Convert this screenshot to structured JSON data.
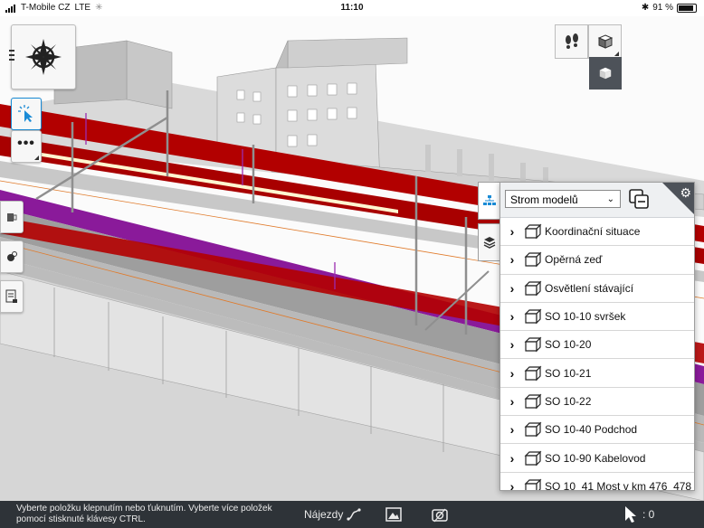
{
  "status_bar": {
    "carrier": "T-Mobile CZ",
    "network": "LTE",
    "time": "11:10",
    "battery": "91 %"
  },
  "colors": {
    "accent": "#1a8bd6",
    "panel_dark": "#4d5259",
    "bottom_bar": "#2e3338",
    "model_red": "#b20000",
    "model_purple": "#8a1a9a"
  },
  "toolbar": {
    "compass_icon": "compass-rose-icon",
    "select_icon": "pointer-select-icon",
    "more_icon": "ellipsis-icon",
    "edge_tools": [
      "section-box-icon",
      "visibility-icon",
      "properties-sheet-icon"
    ],
    "view_modes": [
      "walk-footsteps-icon",
      "3d-cube-icon",
      "3d-cube-dark-icon"
    ]
  },
  "model_tree": {
    "selector_value": "Strom modelů",
    "items": [
      {
        "label": "Koordinační situace"
      },
      {
        "label": "Opěrná zeď"
      },
      {
        "label": "Osvětlení stávající"
      },
      {
        "label": "SO 10-10 svršek"
      },
      {
        "label": "SO 10-20"
      },
      {
        "label": "SO 10-21"
      },
      {
        "label": "SO 10-22"
      },
      {
        "label": "SO 10-40 Podchod"
      },
      {
        "label": "SO 10-90 Kabelovod"
      },
      {
        "label": "SO 10_41 Most v km 476_478"
      }
    ]
  },
  "bottom_bar": {
    "hint": "Vyberte položku klepnutím nebo ťuknutím. Vyberte více položek pomocí stisknuté klávesy CTRL.",
    "najezdy_label": "Nájezdy",
    "selection_count": ": 0"
  }
}
